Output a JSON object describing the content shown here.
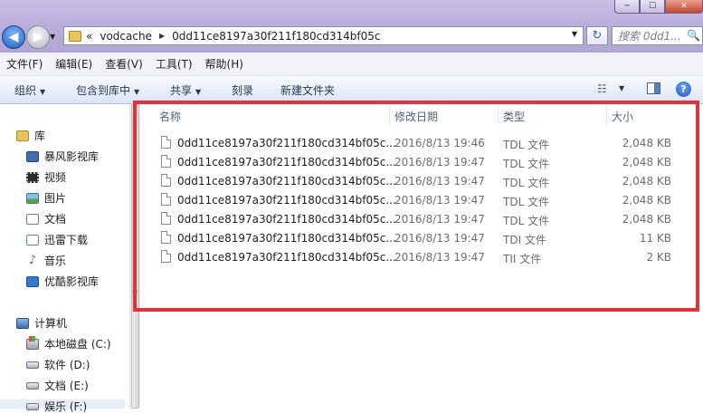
{
  "window": {
    "controls": {
      "minimize": "─",
      "maximize": "☐",
      "close": "✕"
    }
  },
  "nav": {
    "back_glyph": "◀",
    "forward_glyph": "▶",
    "dropdown_glyph": "▼"
  },
  "address": {
    "prefix": "«",
    "segments": [
      "vodcache",
      "0dd11ce8197a30f211f180cd314bf05c"
    ],
    "separator": "▶",
    "dropdown_glyph": "▼"
  },
  "refresh_glyph": "↻",
  "search": {
    "placeholder": "搜索 0dd1...",
    "icon": "🔍"
  },
  "menu": [
    "文件(F)",
    "编辑(E)",
    "查看(V)",
    "工具(T)",
    "帮助(H)"
  ],
  "toolbar": {
    "organize": "组织",
    "include_library": "包含到库中",
    "share": "共享",
    "burn": "刻录",
    "new_folder": "新建文件夹",
    "caret": "▼",
    "view_glyph": "☷",
    "help_glyph": "?"
  },
  "sidebar": {
    "library": "库",
    "library_items": [
      "暴风影视库",
      "视频",
      "图片",
      "文档",
      "迅雷下载",
      "音乐",
      "优酷影视库"
    ],
    "computer": "计算机",
    "drives": [
      "本地磁盘 (C:)",
      "软件 (D:)",
      "文档 (E:)",
      "娱乐 (F:)"
    ],
    "music_glyph": "♪",
    "expand_glyph": "▷",
    "scroll_grip": "≡"
  },
  "table": {
    "headers": {
      "name": "名称",
      "date": "修改日期",
      "type": "类型",
      "size": "大小"
    },
    "rows": [
      {
        "name": "0dd11ce8197a30f211f180cd314bf05c...",
        "date": "2016/8/13 19:46",
        "type": "TDL 文件",
        "size": "2,048 KB"
      },
      {
        "name": "0dd11ce8197a30f211f180cd314bf05c...",
        "date": "2016/8/13 19:47",
        "type": "TDL 文件",
        "size": "2,048 KB"
      },
      {
        "name": "0dd11ce8197a30f211f180cd314bf05c...",
        "date": "2016/8/13 19:47",
        "type": "TDL 文件",
        "size": "2,048 KB"
      },
      {
        "name": "0dd11ce8197a30f211f180cd314bf05c...",
        "date": "2016/8/13 19:47",
        "type": "TDL 文件",
        "size": "2,048 KB"
      },
      {
        "name": "0dd11ce8197a30f211f180cd314bf05c...",
        "date": "2016/8/13 19:47",
        "type": "TDL 文件",
        "size": "2,048 KB"
      },
      {
        "name": "0dd11ce8197a30f211f180cd314bf05c...",
        "date": "2016/8/13 19:47",
        "type": "TDI 文件",
        "size": "11 KB"
      },
      {
        "name": "0dd11ce8197a30f211f180cd314bf05c...",
        "date": "2016/8/13 19:47",
        "type": "TII 文件",
        "size": "2 KB"
      }
    ]
  },
  "colors": {
    "highlight": "#e6303a",
    "title_band": "#b8acd9",
    "command_bar": "#dbe5f4"
  }
}
